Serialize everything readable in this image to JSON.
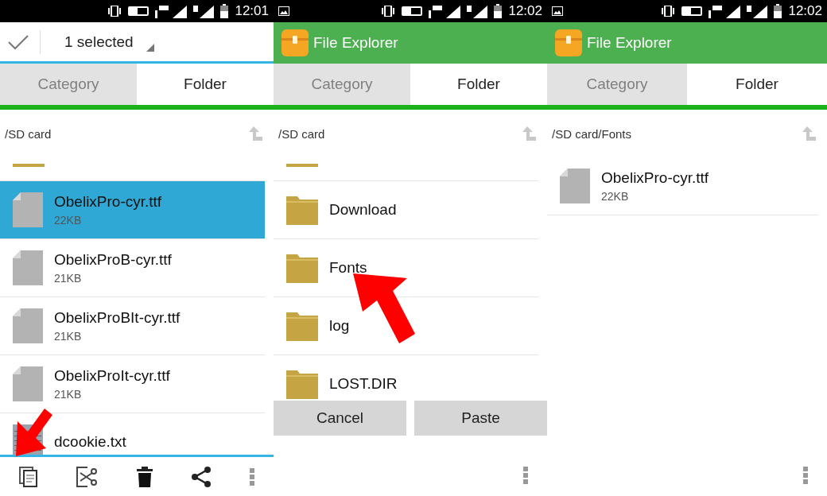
{
  "panels": [
    {
      "status": {
        "time": "12:01",
        "picture_icon": false
      },
      "header": {
        "kind": "selection",
        "label": "1 selected"
      },
      "tabs": [
        {
          "label": "Category",
          "selected": false
        },
        {
          "label": "Folder",
          "selected": true
        }
      ],
      "path": "/SD card",
      "items": [
        {
          "kind": "folder-edge"
        },
        {
          "kind": "file",
          "name": "ObelixPro-cyr.ttf",
          "size": "22KB",
          "selected": true
        },
        {
          "kind": "file",
          "name": "ObelixProB-cyr.ttf",
          "size": "21KB",
          "selected": false
        },
        {
          "kind": "file",
          "name": "ObelixProBIt-cyr.ttf",
          "size": "21KB",
          "selected": false
        },
        {
          "kind": "file",
          "name": "ObelixProIt-cyr.ttf",
          "size": "21KB",
          "selected": false
        },
        {
          "kind": "text",
          "name": "dcookie.txt",
          "selected": false
        }
      ],
      "footer": {
        "kind": "actions",
        "actions": [
          {
            "kind": "copy"
          },
          {
            "kind": "cut"
          },
          {
            "kind": "delete"
          },
          {
            "kind": "share"
          },
          {
            "kind": "more"
          }
        ]
      },
      "annotation": {
        "kind": "arrow-down-left"
      }
    },
    {
      "status": {
        "time": "12:02",
        "picture_icon": true
      },
      "header": {
        "kind": "app",
        "label": "File Explorer"
      },
      "tabs": [
        {
          "label": "Category",
          "selected": false
        },
        {
          "label": "Folder",
          "selected": true
        }
      ],
      "path": "/SD card",
      "items": [
        {
          "kind": "folder-edge"
        },
        {
          "kind": "folder",
          "name": "Download",
          "selected": false
        },
        {
          "kind": "folder",
          "name": "Fonts",
          "selected": false
        },
        {
          "kind": "folder",
          "name": "log",
          "selected": false
        },
        {
          "kind": "folder",
          "name": "LOST.DIR",
          "selected": false
        }
      ],
      "buttons": [
        "Cancel",
        "Paste"
      ],
      "footer": {
        "kind": "menu"
      },
      "annotation": {
        "kind": "arrow-up-left"
      }
    },
    {
      "status": {
        "time": "12:02",
        "picture_icon": true
      },
      "header": {
        "kind": "app",
        "label": "File Explorer"
      },
      "tabs": [
        {
          "label": "Category",
          "selected": false
        },
        {
          "label": "Folder",
          "selected": true
        }
      ],
      "path": "/SD card/Fonts",
      "items": [
        {
          "kind": "file",
          "name": "ObelixPro-cyr.ttf",
          "size": "22KB",
          "selected": false
        }
      ],
      "footer": {
        "kind": "menu"
      }
    }
  ]
}
